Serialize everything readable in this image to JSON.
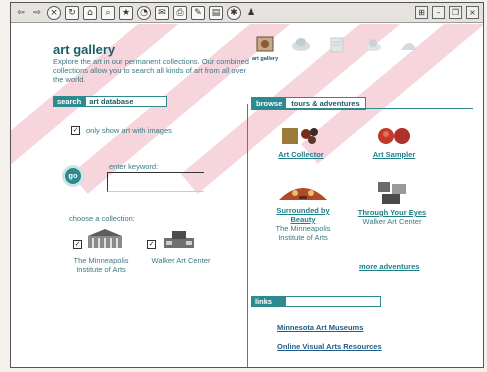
{
  "page": {
    "title": "art gallery",
    "intro": "Explore the art in our permanent collections. Our combined collections allow you to search all kinds of art from all over the world."
  },
  "search": {
    "tab_label": "search",
    "box_label": "art database",
    "checkbox_label": "only show art with images",
    "go_label": "go",
    "keyword_label": "enter keyword:",
    "keyword_value": "",
    "choose_label": "choose a collection:",
    "collections": [
      {
        "label": "The Minneapolis Institute of Arts"
      },
      {
        "label": "Walker Art Center"
      }
    ]
  },
  "top_icons": [
    {
      "label": "art gallery",
      "active": true
    },
    {
      "label": "",
      "active": false
    },
    {
      "label": "",
      "active": false
    },
    {
      "label": "",
      "active": false
    },
    {
      "label": "",
      "active": false
    }
  ],
  "right": {
    "tab_browse": "browse",
    "tab_tours": "tours & adventures",
    "adventures": [
      {
        "link": "Art Collector",
        "sub": ""
      },
      {
        "link": "Art Sampler",
        "sub": ""
      },
      {
        "link": "Surrounded by Beauty",
        "sub": "The Minneapolis Institute of Arts"
      },
      {
        "link": "Through Your Eyes",
        "sub": "Walker Art Center"
      }
    ],
    "more_link": "more adventures",
    "links_tab": "links",
    "resource_links": [
      "Minnesota Art Museums",
      "Online Visual Arts Resources"
    ]
  },
  "colors": {
    "accent": "#2d8a8e",
    "stripe": "#f7d5dd",
    "heading": "#1b5c66"
  },
  "icons": [
    "back-icon",
    "forward-icon",
    "stop-icon",
    "refresh-icon",
    "home-icon",
    "search-icon",
    "favorites-icon",
    "history-icon",
    "mail-icon",
    "print-icon",
    "edit-icon",
    "discuss-icon",
    "messenger-icon"
  ]
}
